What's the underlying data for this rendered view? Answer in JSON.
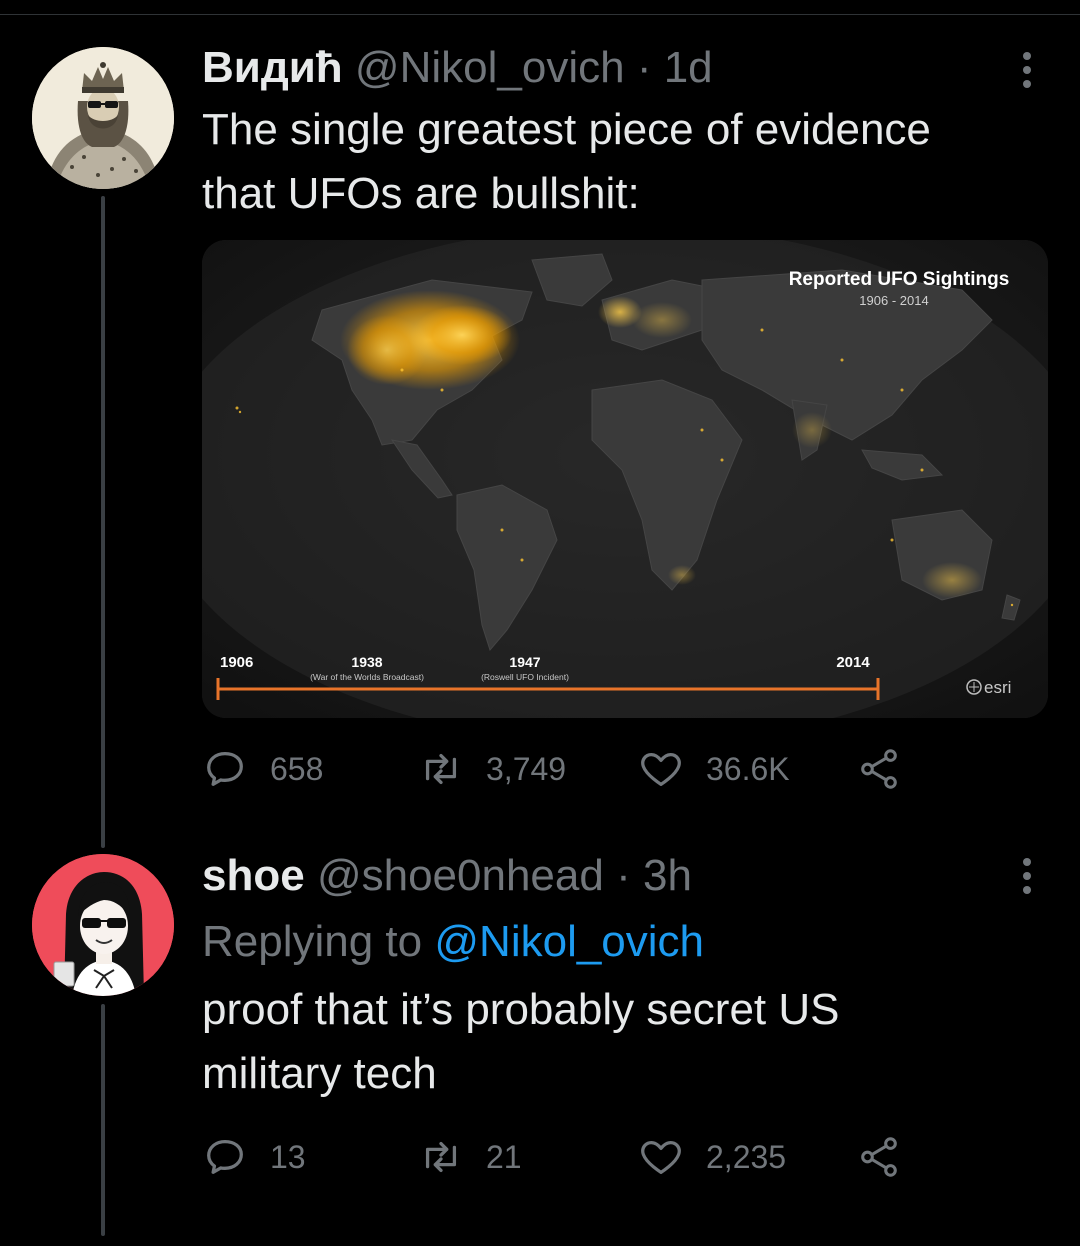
{
  "tweets": [
    {
      "name": "Видић",
      "handle": "@Nikol_ovich",
      "separator": "·",
      "time": "1d",
      "text_line1": "The single greatest piece of evidence",
      "text_line2": "that UFOs are bullshit:",
      "image": {
        "title": "Reported UFO Sightings",
        "subtitle": "1906 - 2014",
        "timeline": {
          "start": "1906",
          "end": "2014",
          "m1_year": "1938",
          "m1_note": "(War of the Worlds Broadcast)",
          "m2_year": "1947",
          "m2_note": "(Roswell UFO Incident)"
        },
        "logo": "esri"
      },
      "replies": "658",
      "retweets": "3,749",
      "likes": "36.6K"
    },
    {
      "name": "shoe",
      "handle": "@shoe0nhead",
      "separator": "·",
      "time": "3h",
      "replying_prefix": "Replying to",
      "replying_handle": "@Nikol_ovich",
      "text_line1": "proof that it’s probably secret US",
      "text_line2": "military tech",
      "replies": "13",
      "retweets": "21",
      "likes": "2,235"
    }
  ],
  "icons": {
    "reply": "reply-icon",
    "retweet": "retweet-icon",
    "like": "heart-icon",
    "share": "share-icon",
    "more": "more-icon"
  },
  "colors": {
    "background": "#000000",
    "text": "#e7e9ea",
    "muted": "#71767b",
    "link": "#1d9bf0",
    "sighting": "#ffb000",
    "timeline": "#e8742a"
  }
}
